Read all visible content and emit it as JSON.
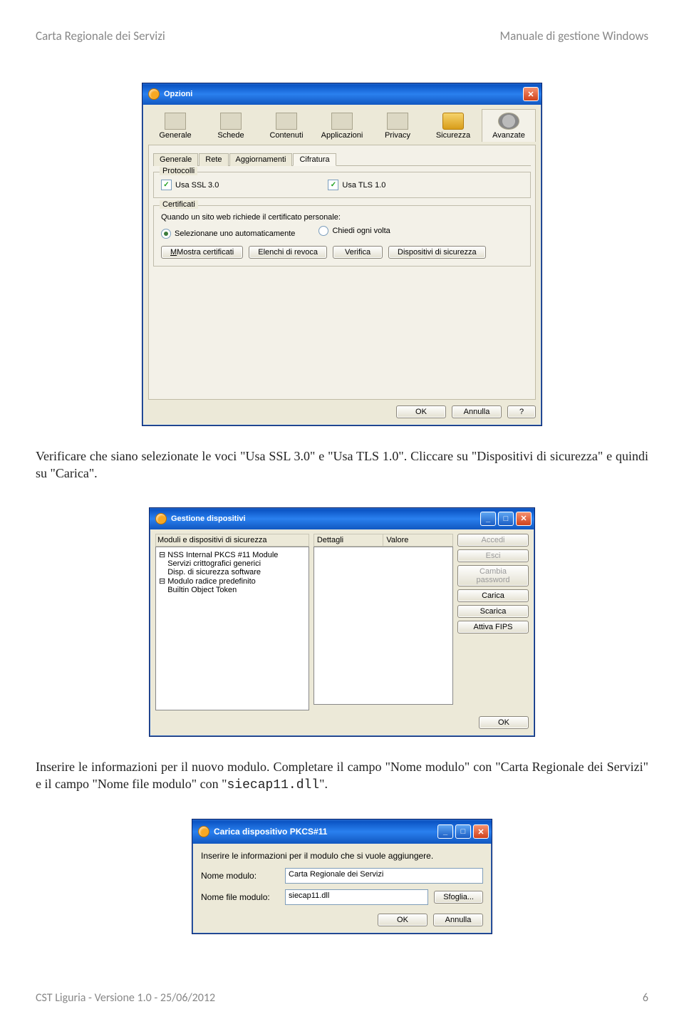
{
  "header": {
    "left": "Carta Regionale dei Servizi",
    "right": "Manuale di gestione Windows"
  },
  "para1": "Verificare che siano selezionate le voci \"Usa SSL 3.0\" e \"Usa TLS 1.0\". Cliccare su \"Dispositivi di sicurezza\" e quindi su \"Carica\".",
  "para2_a": "Inserire le informazioni per il nuovo modulo. Completare il campo \"Nome modulo\" con \"Carta Regionale dei Servizi\" e il campo \"Nome file modulo\" con \"",
  "para2_code": "siecap11.dll",
  "para2_b": "\".",
  "footer": {
    "left": "CST Liguria - Versione 1.0 - 25/06/2012",
    "right": "6"
  },
  "dlg1": {
    "title": "Opzioni",
    "tabs": [
      "Generale",
      "Schede",
      "Contenuti",
      "Applicazioni",
      "Privacy",
      "Sicurezza",
      "Avanzate"
    ],
    "subtabs": [
      "Generale",
      "Rete",
      "Aggiornamenti",
      "Cifratura"
    ],
    "group_protocolli": "Protocolli",
    "chk_ssl": "Usa SSL 3.0",
    "chk_tls": "Usa TLS 1.0",
    "group_certificati": "Certificati",
    "cert_text": "Quando un sito web richiede il certificato personale:",
    "radio_auto": "Selezionane uno automaticamente",
    "radio_ask": "Chiedi ogni volta",
    "btn_mostra": "Mostra certificati",
    "btn_elenchi": "Elenchi di revoca",
    "btn_verifica": "Verifica",
    "btn_disp": "Dispositivi di sicurezza",
    "btn_ok": "OK",
    "btn_ann": "Annulla",
    "btn_help": "?"
  },
  "dlg2": {
    "title": "Gestione dispositivi",
    "col1": "Moduli e dispositivi di sicurezza",
    "col2": "Dettagli",
    "col3": "Valore",
    "tree": [
      "⊟ NSS Internal PKCS #11 Module",
      "    Servizi crittografici generici",
      "    Disp. di sicurezza software",
      "⊟ Modulo radice predefinito",
      "    Builtin Object Token"
    ],
    "btn_accedi": "Accedi",
    "btn_esci": "Esci",
    "btn_pwd": "Cambia password",
    "btn_carica": "Carica",
    "btn_scarica": "Scarica",
    "btn_fips": "Attiva FIPS",
    "btn_ok": "OK"
  },
  "dlg3": {
    "title": "Carica dispositivo PKCS#11",
    "instr": "Inserire le informazioni per il modulo che si vuole aggiungere.",
    "lbl_nome": "Nome modulo:",
    "val_nome": "Carta Regionale dei Servizi",
    "lbl_file": "Nome file modulo:",
    "val_file": "siecap11.dll",
    "btn_sfoglia": "Sfoglia...",
    "btn_ok": "OK",
    "btn_ann": "Annulla"
  }
}
